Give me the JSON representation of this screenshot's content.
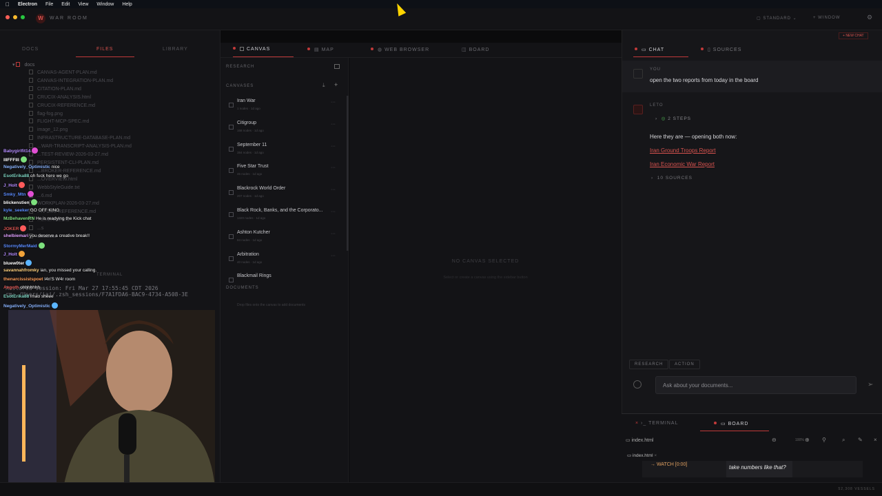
{
  "menubar": {
    "app": "Electron",
    "items": [
      "File",
      "Edit",
      "View",
      "Window",
      "Help"
    ]
  },
  "header": {
    "title": "WAR ROOM",
    "logo_letter": "W",
    "mode": "STANDARD",
    "window": "WINDOW",
    "new_chat": "NEW CHAT"
  },
  "left": {
    "tabs": [
      "DOCS",
      "FILES",
      "LIBRARY"
    ],
    "folder": "docs",
    "files": [
      "CANVAS-AGENT-PLAN.md",
      "CANVAS-INTEGRATION-PLAN.md",
      "CITATION-PLAN.md",
      "CRUCIX-ANALYSIS.html",
      "CRUCIX-REFERENCE.md",
      "flag-fog.png",
      "FLIGHT-MCP-SPEC.md",
      "image_12.png",
      "INFRASTRUCTURE-DATABASE-PLAN.md",
      "...WAR-TRANSCRIPT-ANALYSIS-PLAN.md",
      "...TEST-REVIEW-2026-03-27.md",
      "PERSISTENT-CLI-PLAN.md",
      "...BROKER-REFERENCE.md",
      "...OVERVIEW.html",
      "WebbStyleGuide.txt",
      "...6.md",
      "WORKPLAN-2026-03-27.md",
      "...N-OSS-REFERENCE.md",
      "...ERENCE.md",
      "...s",
      "database"
    ],
    "terminal_label": "TERMINAL",
    "terminal_lines": [
      "Restored session: Fri Mar 27 17:55:45 CDT 2026",
      "rm: /Users/iaj/.zsh_sessions/F7A1FDA6-BAC9-4734-A508-3E"
    ]
  },
  "chat_overlay": [
    {
      "user": "Babygirlfit14",
      "msg": "",
      "color": "#b58cff"
    },
    {
      "user": "lIIFFFIII",
      "msg": "",
      "color": "#ffffff"
    },
    {
      "user": "Negatively_Optimistic",
      "msg": "nice",
      "color": "#8ab4ff"
    },
    {
      "user": "EsotErika88",
      "msg": "oh fuck here we go",
      "color": "#7dd3c0"
    },
    {
      "user": "J_Holt",
      "msg": "",
      "color": "#b58cff"
    },
    {
      "user": "Smky_Mtn",
      "msg": "",
      "color": "#5b8cff"
    },
    {
      "user": "blickenstien",
      "msg": "",
      "color": "#ffffff"
    },
    {
      "user": "kyle_seeker",
      "msg": "GO OFF KING",
      "color": "#5b8cff"
    },
    {
      "user": "MzBehavenRN",
      "msg": "He is readying the Kick chat",
      "color": "#7fe07f"
    },
    {
      "user": "JOKER",
      "msg": "",
      "color": "#d9534f"
    },
    {
      "user": "shelbiemari",
      "msg": "you deserve a creative break!!",
      "color": "#e0a0ff"
    },
    {
      "user": "StormyMerMaid",
      "msg": "",
      "color": "#5b8cff"
    },
    {
      "user": "J_Holt",
      "msg": "",
      "color": "#b58cff"
    },
    {
      "user": "bluew0ter",
      "msg": "",
      "color": "#ffffff"
    },
    {
      "user": "savannahfromky",
      "msg": "ian, you missed your calling.",
      "color": "#ffd27f"
    },
    {
      "user": "thenarcissistspoet",
      "msg": "I4n'S W4r room",
      "color": "#ff9f5b"
    },
    {
      "user": "Aegoth",
      "msg": "ohhhhhhh",
      "color": "#d9534f"
    },
    {
      "user": "EsotErika88",
      "msg": "lmao sheee",
      "color": "#7dd3c0"
    },
    {
      "user": "Negatively_Optimistic",
      "msg": "",
      "color": "#8ab4ff"
    }
  ],
  "middle": {
    "tabs": [
      "CANVAS",
      "MAP",
      "WEB BROWSER",
      "BOARD"
    ],
    "research_label": "RESEARCH",
    "canvases_label": "CANVASES",
    "canvases": [
      {
        "name": "Iran War",
        "meta": "1 nodes · 1d ago"
      },
      {
        "name": "Citigroup",
        "meta": "168 nodes · 1d ago"
      },
      {
        "name": "September 11",
        "meta": "384 nodes · 1d ago"
      },
      {
        "name": "Five Star Trust",
        "meta": "46 nodes · 1d ago"
      },
      {
        "name": "Blackrock World Order",
        "meta": "207 nodes · 1d ago"
      },
      {
        "name": "Black Rock, Banks, and the Corporato...",
        "meta": "1320 nodes · 1d ago"
      },
      {
        "name": "Ashton Kutcher",
        "meta": "84 nodes · 1d ago"
      },
      {
        "name": "Arbitration",
        "meta": "40 nodes · 1d ago"
      },
      {
        "name": "Blackmail Rings",
        "meta": ""
      }
    ],
    "documents_label": "DOCUMENTS",
    "documents_hint": "Drop files onto the canvas to add documents",
    "empty_title": "NO CANVAS SELECTED",
    "empty_hint": "Select or create a canvas using the sidebar button"
  },
  "right": {
    "tabs": [
      "CHAT",
      "SOURCES"
    ],
    "you_label": "YOU",
    "you_msg": "open the two reports from today in the board",
    "bot_label": "LETO",
    "steps": "2 STEPS",
    "reply": "Here they are — opening both now:",
    "links": [
      "Iran Ground Troops Report",
      "Iran Economic War Report"
    ],
    "sources": "10 SOURCES",
    "modes": [
      "RESEARCH",
      "ACTION"
    ],
    "input_placeholder": "Ask about your documents..."
  },
  "bottom": {
    "tabs": [
      "TERMINAL",
      "BOARD"
    ],
    "file": "index.html",
    "zoom": "100%",
    "file_tab": "index.html",
    "watch": "→ WATCH [0:00]",
    "caption": "take numbers like that?"
  },
  "status": {
    "right": "52,308 VESSELS"
  }
}
